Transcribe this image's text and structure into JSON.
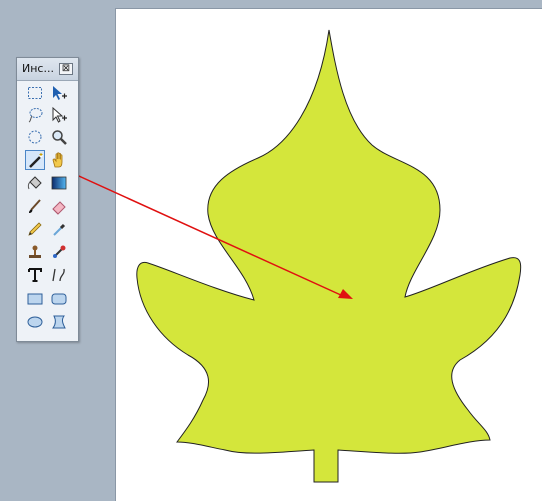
{
  "toolbox": {
    "title": "Инс...",
    "close_glyph": "⊠",
    "tools": [
      {
        "icon": "rectangle-select-icon"
      },
      {
        "icon": "move-selection-icon"
      },
      {
        "icon": "lasso-select-icon"
      },
      {
        "icon": "move-selected-icon"
      },
      {
        "icon": "ellipse-select-icon"
      },
      {
        "icon": "zoom-icon"
      },
      {
        "icon": "magic-wand-icon",
        "active": true
      },
      {
        "icon": "pan-hand-icon"
      },
      {
        "icon": "paint-bucket-icon"
      },
      {
        "icon": "gradient-icon"
      },
      {
        "icon": "paintbrush-icon"
      },
      {
        "icon": "eraser-icon"
      },
      {
        "icon": "pencil-icon"
      },
      {
        "icon": "color-picker-icon"
      },
      {
        "icon": "clone-stamp-icon"
      },
      {
        "icon": "recolor-icon"
      },
      {
        "icon": "text-icon"
      },
      {
        "icon": "line-curve-icon"
      },
      {
        "icon": "rectangle-icon"
      },
      {
        "icon": "rounded-rectangle-icon"
      },
      {
        "icon": "ellipse-icon"
      },
      {
        "icon": "freeform-shape-icon"
      }
    ]
  },
  "colors": {
    "workspace": "#a9b6c4",
    "leaf_fill": "#d4e63b",
    "arrow": "#e01010"
  }
}
